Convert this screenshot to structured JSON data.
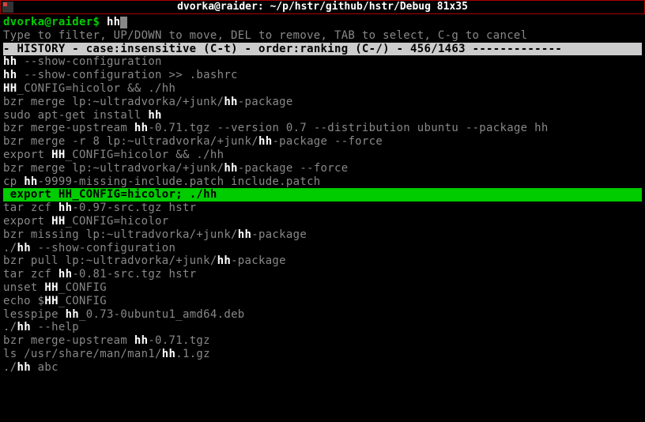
{
  "titlebar": {
    "title": "dvorka@raider: ~/p/hstr/github/hstr/Debug 81x35"
  },
  "prompt": {
    "user_host": "dvorka@raider$",
    "typed": "hh"
  },
  "help": "Type to filter, UP/DOWN to move, DEL to remove, TAB to select, C-g to cancel",
  "header": {
    "prefix": "- HISTORY - case:",
    "case_mode": "insensitive",
    "case_key": " (C-t) - order:",
    "order_mode": "ranking",
    "order_key": " (C-/) - ",
    "count": "456/1463",
    "suffix": " -------------"
  },
  "entries": [
    {
      "parts": [
        {
          "hl": true,
          "t": "hh"
        },
        {
          "hl": false,
          "t": " --show-configuration"
        }
      ]
    },
    {
      "parts": [
        {
          "hl": true,
          "t": "hh"
        },
        {
          "hl": false,
          "t": " --show-configuration >> .bashrc"
        }
      ]
    },
    {
      "parts": [
        {
          "hl": true,
          "t": "HH"
        },
        {
          "hl": false,
          "t": "_CONFIG=hicolor && ./hh"
        }
      ]
    },
    {
      "parts": [
        {
          "hl": false,
          "t": "bzr merge lp:~ultradvorka/+junk/"
        },
        {
          "hl": true,
          "t": "hh"
        },
        {
          "hl": false,
          "t": "-package"
        }
      ]
    },
    {
      "parts": [
        {
          "hl": false,
          "t": "sudo apt-get install "
        },
        {
          "hl": true,
          "t": "hh"
        }
      ]
    },
    {
      "parts": [
        {
          "hl": false,
          "t": "bzr merge-upstream "
        },
        {
          "hl": true,
          "t": "hh"
        },
        {
          "hl": false,
          "t": "-0.71.tgz --version 0.7 --distribution ubuntu --package hh"
        }
      ]
    },
    {
      "parts": [
        {
          "hl": false,
          "t": "bzr merge -r 8 lp:~ultradvorka/+junk/"
        },
        {
          "hl": true,
          "t": "hh"
        },
        {
          "hl": false,
          "t": "-package --force"
        }
      ]
    },
    {
      "parts": [
        {
          "hl": false,
          "t": "export "
        },
        {
          "hl": true,
          "t": "HH"
        },
        {
          "hl": false,
          "t": "_CONFIG=hicolor && ./hh"
        }
      ]
    },
    {
      "parts": [
        {
          "hl": false,
          "t": "bzr merge lp:~ultradvorka/+junk/"
        },
        {
          "hl": true,
          "t": "hh"
        },
        {
          "hl": false,
          "t": "-package --force"
        }
      ]
    },
    {
      "parts": [
        {
          "hl": false,
          "t": "cp "
        },
        {
          "hl": true,
          "t": "hh"
        },
        {
          "hl": false,
          "t": "-9999-missing-include.patch include.patch"
        }
      ]
    },
    {
      "selected": true,
      "parts": [
        {
          "hl": false,
          "t": " export "
        },
        {
          "hl": true,
          "t": "HH"
        },
        {
          "hl": false,
          "t": "_CONFIG=hicolor; ./hh"
        }
      ]
    },
    {
      "parts": [
        {
          "hl": false,
          "t": "tar zcf "
        },
        {
          "hl": true,
          "t": "hh"
        },
        {
          "hl": false,
          "t": "-0.97-src.tgz hstr"
        }
      ]
    },
    {
      "parts": [
        {
          "hl": false,
          "t": "export "
        },
        {
          "hl": true,
          "t": "HH"
        },
        {
          "hl": false,
          "t": "_CONFIG=hicolor"
        }
      ]
    },
    {
      "parts": [
        {
          "hl": false,
          "t": "bzr missing lp:~ultradvorka/+junk/"
        },
        {
          "hl": true,
          "t": "hh"
        },
        {
          "hl": false,
          "t": "-package"
        }
      ]
    },
    {
      "parts": [
        {
          "hl": false,
          "t": "./"
        },
        {
          "hl": true,
          "t": "hh"
        },
        {
          "hl": false,
          "t": " --show-configuration"
        }
      ]
    },
    {
      "parts": [
        {
          "hl": false,
          "t": "bzr pull lp:~ultradvorka/+junk/"
        },
        {
          "hl": true,
          "t": "hh"
        },
        {
          "hl": false,
          "t": "-package"
        }
      ]
    },
    {
      "parts": [
        {
          "hl": false,
          "t": "tar zcf "
        },
        {
          "hl": true,
          "t": "hh"
        },
        {
          "hl": false,
          "t": "-0.81-src.tgz hstr"
        }
      ]
    },
    {
      "parts": [
        {
          "hl": false,
          "t": "unset "
        },
        {
          "hl": true,
          "t": "HH"
        },
        {
          "hl": false,
          "t": "_CONFIG"
        }
      ]
    },
    {
      "parts": [
        {
          "hl": false,
          "t": "echo $"
        },
        {
          "hl": true,
          "t": "HH"
        },
        {
          "hl": false,
          "t": "_CONFIG"
        }
      ]
    },
    {
      "parts": [
        {
          "hl": false,
          "t": "lesspipe "
        },
        {
          "hl": true,
          "t": "hh"
        },
        {
          "hl": false,
          "t": "_0.73-0ubuntu1_amd64.deb"
        }
      ]
    },
    {
      "parts": [
        {
          "hl": false,
          "t": "./"
        },
        {
          "hl": true,
          "t": "hh"
        },
        {
          "hl": false,
          "t": " --help"
        }
      ]
    },
    {
      "parts": [
        {
          "hl": false,
          "t": "bzr merge-upstream "
        },
        {
          "hl": true,
          "t": "hh"
        },
        {
          "hl": false,
          "t": "-0.71.tgz"
        }
      ]
    },
    {
      "parts": [
        {
          "hl": false,
          "t": "ls /usr/share/man/man1/"
        },
        {
          "hl": true,
          "t": "hh"
        },
        {
          "hl": false,
          "t": ".1.gz"
        }
      ]
    },
    {
      "parts": [
        {
          "hl": false,
          "t": "./"
        },
        {
          "hl": true,
          "t": "hh"
        },
        {
          "hl": false,
          "t": " abc"
        }
      ]
    }
  ]
}
